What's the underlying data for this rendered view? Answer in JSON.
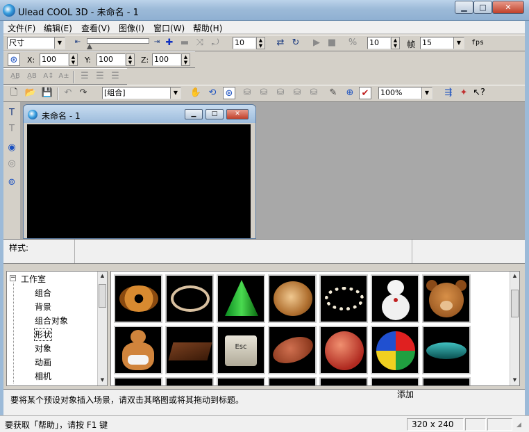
{
  "window": {
    "title": "Ulead COOL 3D - 未命名 - 1"
  },
  "menu": [
    "文件(F)",
    "编辑(E)",
    "查看(V)",
    "图像(I)",
    "窗口(W)",
    "帮助(H)"
  ],
  "toolbar1": {
    "size_combo": "尺寸",
    "value_a": "10",
    "value_b": "10",
    "frame_label": "帧",
    "fps_value": "15",
    "fps_label": "fps"
  },
  "toolbar2": {
    "x_label": "X:",
    "x_value": "100",
    "y_label": "Y:",
    "y_value": "100",
    "z_label": "Z:",
    "z_value": "100"
  },
  "toolbar4": {
    "group_combo": "[组合]",
    "zoom_combo": "100%"
  },
  "doc_window": {
    "title": "未命名 - 1"
  },
  "style_bar": {
    "label": "样式:"
  },
  "tree": {
    "root": "工作室",
    "items": [
      "组合",
      "背景",
      "组合对象",
      "形状",
      "对象",
      "动画",
      "相机"
    ]
  },
  "gallery": {
    "row1": [
      "donut-thumbnail",
      "ring-thumbnail",
      "cone-thumbnail",
      "wood-disc-thumbnail",
      "pearl-necklace-thumbnail",
      "snowman-thumbnail",
      "bear-thumbnail"
    ],
    "row2": [
      "gingerbread-thumbnail",
      "chocolate-bar-thumbnail",
      "esc-key-thumbnail",
      "football-thumbnail",
      "basketball-thumbnail",
      "beach-ball-thumbnail",
      "spinning-top-thumbnail"
    ],
    "esc_key_label": "Esc"
  },
  "hint": {
    "text": "要将某个预设对象插入场景，请双击其略图或将其拖动到标题。",
    "add_label": "添加"
  },
  "status": {
    "help_text": "要获取「帮助」，请按 F1 键",
    "dimensions": "320 x 240"
  },
  "colors": {
    "canvas": "#000000",
    "workspace": "#a8a8a8",
    "title_bar": "#9cbad8"
  }
}
